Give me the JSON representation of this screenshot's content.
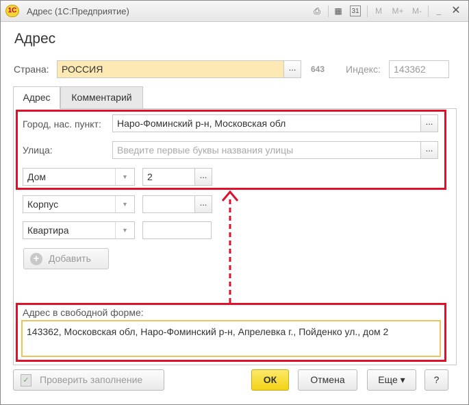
{
  "window": {
    "title": "Адрес  (1С:Предприятие)",
    "app_icon": "1C",
    "toolbar_icons": [
      "print-icon",
      "calculator-icon",
      "calendar-icon",
      "m-icon",
      "m-plus-icon",
      "m-minus-icon",
      "minimize-icon",
      "maximize-icon",
      "close-icon"
    ],
    "toolbar_glyphs": {
      "print": "⎙",
      "calc": "▦",
      "calendar": "31",
      "m": "M",
      "m_plus": "M+",
      "m_minus": "M-",
      "minimize": "_",
      "maximize": "□",
      "close": "✕"
    }
  },
  "form": {
    "heading": "Адрес",
    "country_label": "Страна:",
    "country_value": "РОССИЯ",
    "country_code": "643",
    "index_label": "Индекс:",
    "index_value": "143362",
    "dots": "..."
  },
  "tabs": [
    {
      "label": "Адрес",
      "active": true
    },
    {
      "label": "Комментарий",
      "active": false
    }
  ],
  "address": {
    "city_label": "Город, нас. пункт:",
    "city_value": "Наро-Фоминский р-н, Московская обл",
    "street_label": "Улица:",
    "street_placeholder": "Введите первые буквы названия улицы",
    "rows": [
      {
        "type": "Дом",
        "value": "2"
      },
      {
        "type": "Корпус",
        "value": ""
      },
      {
        "type": "Квартира",
        "value": ""
      }
    ],
    "dropdown_arrow": "▼",
    "add_button": "Добавить",
    "add_icon": "+",
    "free_form_label": "Адрес в свободной форме:",
    "free_form_value": "143362, Московская обл, Наро-Фоминский р-н, Апрелевка г., Пойденко ул., дом 2"
  },
  "footer": {
    "check_button": "Проверить заполнение",
    "check_icon": "✓",
    "ok_button": "ОК",
    "cancel_button": "Отмена",
    "more_button": "Еще",
    "more_arrow": "▾",
    "help_button": "?"
  },
  "colors": {
    "highlight_box": "#e0102a",
    "arrow": "#e0102a",
    "ok_button": "#f3d215",
    "country_field": "#fde9b4",
    "free_form_border": "#e9c55c"
  }
}
